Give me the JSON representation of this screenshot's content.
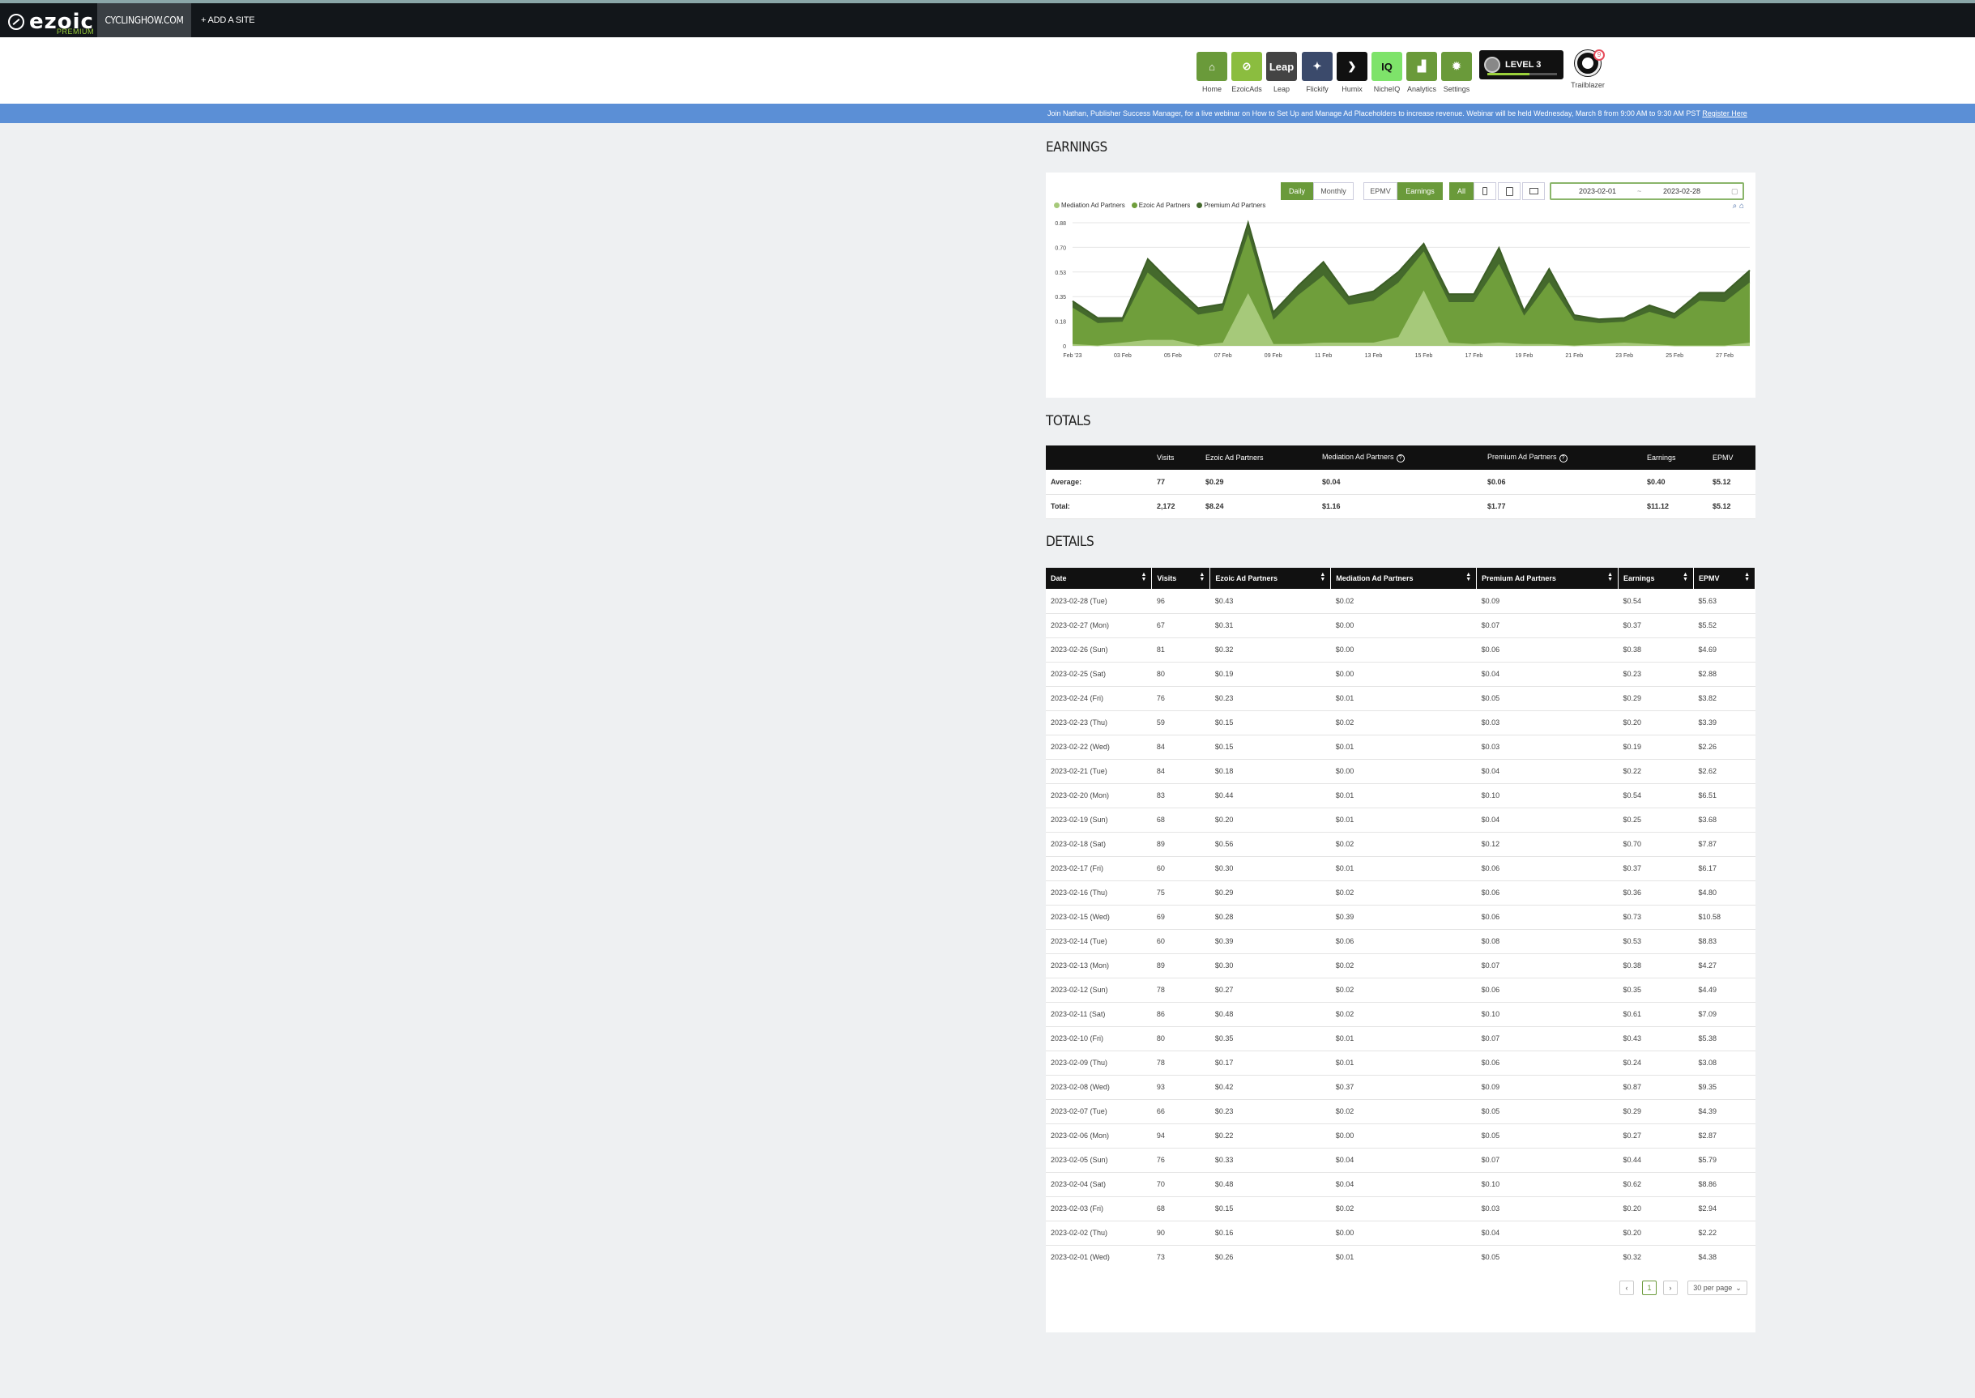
{
  "topbar": {
    "logo_text": "ezoic",
    "logo_sub": "PREMIUM",
    "site": "CYCLINGHOW.COM",
    "add_site": "+ ADD A SITE"
  },
  "apps": [
    {
      "label": "Home",
      "icon": "home-icon",
      "color": "#6a9a3a"
    },
    {
      "label": "EzoicAds",
      "icon": "ezoicads-icon",
      "color": "#8bbd3f"
    },
    {
      "label": "Leap",
      "icon": "leap-icon",
      "color": "#444444",
      "text": "Leap"
    },
    {
      "label": "Flickify",
      "icon": "flickify-icon",
      "color": "#3b4a6b"
    },
    {
      "label": "Humix",
      "icon": "humix-icon",
      "color": "#111111"
    },
    {
      "label": "NicheIQ",
      "icon": "iq-icon",
      "color": "#7ee36a",
      "text": "IQ"
    },
    {
      "label": "Analytics",
      "icon": "analytics-icon",
      "color": "#6a9a3a"
    },
    {
      "label": "Settings",
      "icon": "gear-icon",
      "color": "#6a9a3a"
    }
  ],
  "level": {
    "text": "LEVEL 3"
  },
  "trailblazer": {
    "label": "Trailblazer",
    "badge": "9"
  },
  "banner": {
    "text": "Join Nathan, Publisher Success Manager, for a live webinar on How to Set Up and Manage Ad Placeholders to increase revenue. Webinar will be held Wednesday, March 8 from 9:00 AM to 9:30 AM PST",
    "link": "Register Here"
  },
  "earnings": {
    "title": "EARNINGS",
    "controls": {
      "daily": "Daily",
      "monthly": "Monthly",
      "epmv": "EPMV",
      "earnings": "Earnings",
      "all": "All"
    },
    "date_from": "2023-02-01",
    "date_sep": "~",
    "date_to": "2023-02-28"
  },
  "chart_data": {
    "type": "area",
    "stacked": true,
    "x": [
      "Feb '23",
      "02 Feb",
      "03 Feb",
      "04 Feb",
      "05 Feb",
      "06 Feb",
      "07 Feb",
      "08 Feb",
      "09 Feb",
      "10 Feb",
      "11 Feb",
      "12 Feb",
      "13 Feb",
      "14 Feb",
      "15 Feb",
      "16 Feb",
      "17 Feb",
      "18 Feb",
      "19 Feb",
      "20 Feb",
      "21 Feb",
      "22 Feb",
      "23 Feb",
      "24 Feb",
      "25 Feb",
      "26 Feb",
      "27 Feb",
      "28 Feb"
    ],
    "tick_labels": [
      "Feb '23",
      "03 Feb",
      "05 Feb",
      "07 Feb",
      "09 Feb",
      "11 Feb",
      "13 Feb",
      "15 Feb",
      "17 Feb",
      "19 Feb",
      "21 Feb",
      "23 Feb",
      "25 Feb",
      "27 Feb"
    ],
    "series": [
      {
        "name": "Mediation Ad Partners",
        "color": "#a6c97a",
        "values": [
          0.01,
          0.0,
          0.02,
          0.04,
          0.04,
          0.0,
          0.02,
          0.37,
          0.01,
          0.01,
          0.02,
          0.02,
          0.02,
          0.06,
          0.39,
          0.02,
          0.01,
          0.02,
          0.01,
          0.01,
          0.0,
          0.01,
          0.02,
          0.01,
          0.0,
          0.0,
          0.0,
          0.02
        ]
      },
      {
        "name": "Ezoic Ad Partners",
        "color": "#6f9e3b",
        "values": [
          0.26,
          0.16,
          0.15,
          0.48,
          0.33,
          0.22,
          0.23,
          0.42,
          0.17,
          0.35,
          0.48,
          0.27,
          0.3,
          0.39,
          0.28,
          0.29,
          0.3,
          0.56,
          0.2,
          0.44,
          0.18,
          0.15,
          0.15,
          0.23,
          0.19,
          0.32,
          0.31,
          0.43
        ]
      },
      {
        "name": "Premium Ad Partners",
        "color": "#44692c",
        "values": [
          0.05,
          0.04,
          0.03,
          0.1,
          0.07,
          0.05,
          0.05,
          0.09,
          0.06,
          0.07,
          0.1,
          0.06,
          0.07,
          0.08,
          0.06,
          0.06,
          0.06,
          0.12,
          0.04,
          0.1,
          0.04,
          0.03,
          0.03,
          0.05,
          0.04,
          0.06,
          0.07,
          0.09
        ]
      }
    ],
    "y_ticks": [
      "0",
      "0.18",
      "0.35",
      "0.53",
      "0.70",
      "0.88"
    ],
    "ylim": [
      0,
      0.88
    ],
    "legend_position": "top-left",
    "grid": true
  },
  "totals": {
    "title": "TOTALS",
    "headers": [
      "",
      "Visits",
      "Ezoic Ad Partners",
      "Mediation Ad Partners",
      "Premium Ad Partners",
      "Earnings",
      "EPMV"
    ],
    "rows": [
      [
        "Average:",
        "77",
        "$0.29",
        "$0.04",
        "$0.06",
        "$0.40",
        "$5.12"
      ],
      [
        "Total:",
        "2,172",
        "$8.24",
        "$1.16",
        "$1.77",
        "$11.12",
        "$5.12"
      ]
    ]
  },
  "details": {
    "title": "DETAILS",
    "headers": [
      "Date",
      "Visits",
      "Ezoic Ad Partners",
      "Mediation Ad Partners",
      "Premium Ad Partners",
      "Earnings",
      "EPMV"
    ],
    "rows": [
      [
        "2023-02-28 (Tue)",
        "96",
        "$0.43",
        "$0.02",
        "$0.09",
        "$0.54",
        "$5.63"
      ],
      [
        "2023-02-27 (Mon)",
        "67",
        "$0.31",
        "$0.00",
        "$0.07",
        "$0.37",
        "$5.52"
      ],
      [
        "2023-02-26 (Sun)",
        "81",
        "$0.32",
        "$0.00",
        "$0.06",
        "$0.38",
        "$4.69"
      ],
      [
        "2023-02-25 (Sat)",
        "80",
        "$0.19",
        "$0.00",
        "$0.04",
        "$0.23",
        "$2.88"
      ],
      [
        "2023-02-24 (Fri)",
        "76",
        "$0.23",
        "$0.01",
        "$0.05",
        "$0.29",
        "$3.82"
      ],
      [
        "2023-02-23 (Thu)",
        "59",
        "$0.15",
        "$0.02",
        "$0.03",
        "$0.20",
        "$3.39"
      ],
      [
        "2023-02-22 (Wed)",
        "84",
        "$0.15",
        "$0.01",
        "$0.03",
        "$0.19",
        "$2.26"
      ],
      [
        "2023-02-21 (Tue)",
        "84",
        "$0.18",
        "$0.00",
        "$0.04",
        "$0.22",
        "$2.62"
      ],
      [
        "2023-02-20 (Mon)",
        "83",
        "$0.44",
        "$0.01",
        "$0.10",
        "$0.54",
        "$6.51"
      ],
      [
        "2023-02-19 (Sun)",
        "68",
        "$0.20",
        "$0.01",
        "$0.04",
        "$0.25",
        "$3.68"
      ],
      [
        "2023-02-18 (Sat)",
        "89",
        "$0.56",
        "$0.02",
        "$0.12",
        "$0.70",
        "$7.87"
      ],
      [
        "2023-02-17 (Fri)",
        "60",
        "$0.30",
        "$0.01",
        "$0.06",
        "$0.37",
        "$6.17"
      ],
      [
        "2023-02-16 (Thu)",
        "75",
        "$0.29",
        "$0.02",
        "$0.06",
        "$0.36",
        "$4.80"
      ],
      [
        "2023-02-15 (Wed)",
        "69",
        "$0.28",
        "$0.39",
        "$0.06",
        "$0.73",
        "$10.58"
      ],
      [
        "2023-02-14 (Tue)",
        "60",
        "$0.39",
        "$0.06",
        "$0.08",
        "$0.53",
        "$8.83"
      ],
      [
        "2023-02-13 (Mon)",
        "89",
        "$0.30",
        "$0.02",
        "$0.07",
        "$0.38",
        "$4.27"
      ],
      [
        "2023-02-12 (Sun)",
        "78",
        "$0.27",
        "$0.02",
        "$0.06",
        "$0.35",
        "$4.49"
      ],
      [
        "2023-02-11 (Sat)",
        "86",
        "$0.48",
        "$0.02",
        "$0.10",
        "$0.61",
        "$7.09"
      ],
      [
        "2023-02-10 (Fri)",
        "80",
        "$0.35",
        "$0.01",
        "$0.07",
        "$0.43",
        "$5.38"
      ],
      [
        "2023-02-09 (Thu)",
        "78",
        "$0.17",
        "$0.01",
        "$0.06",
        "$0.24",
        "$3.08"
      ],
      [
        "2023-02-08 (Wed)",
        "93",
        "$0.42",
        "$0.37",
        "$0.09",
        "$0.87",
        "$9.35"
      ],
      [
        "2023-02-07 (Tue)",
        "66",
        "$0.23",
        "$0.02",
        "$0.05",
        "$0.29",
        "$4.39"
      ],
      [
        "2023-02-06 (Mon)",
        "94",
        "$0.22",
        "$0.00",
        "$0.05",
        "$0.27",
        "$2.87"
      ],
      [
        "2023-02-05 (Sun)",
        "76",
        "$0.33",
        "$0.04",
        "$0.07",
        "$0.44",
        "$5.79"
      ],
      [
        "2023-02-04 (Sat)",
        "70",
        "$0.48",
        "$0.04",
        "$0.10",
        "$0.62",
        "$8.86"
      ],
      [
        "2023-02-03 (Fri)",
        "68",
        "$0.15",
        "$0.02",
        "$0.03",
        "$0.20",
        "$2.94"
      ],
      [
        "2023-02-02 (Thu)",
        "90",
        "$0.16",
        "$0.00",
        "$0.04",
        "$0.20",
        "$2.22"
      ],
      [
        "2023-02-01 (Wed)",
        "73",
        "$0.26",
        "$0.01",
        "$0.05",
        "$0.32",
        "$4.38"
      ]
    ]
  },
  "pagination": {
    "prev": "‹",
    "page": "1",
    "next": "›",
    "per_page": "30 per page"
  }
}
